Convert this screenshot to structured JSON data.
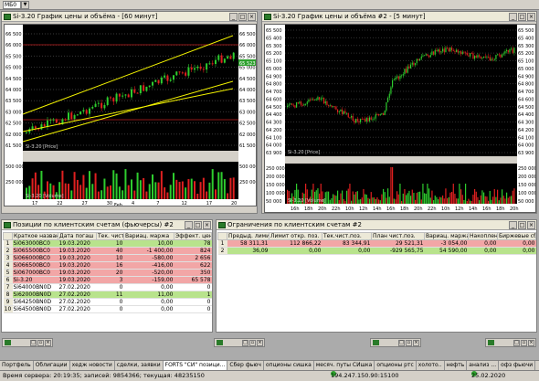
{
  "toolbar": {
    "combo_value": "MБ0"
  },
  "chart1": {
    "title": "Si-3.20 График цены и объёма - [60 минут]",
    "price_axis": [
      "66 500",
      "66 000",
      "65 500",
      "65 000",
      "64 500",
      "64 000",
      "63 500",
      "63 000",
      "62 500",
      "62 000",
      "61 500"
    ],
    "last_price": "65 523",
    "price_label": "Si-3.20 [Price]",
    "volume_axis": [
      "500 000",
      "250 000"
    ],
    "volume_label": "Si-3.20 [Volume]",
    "date_ticks": [
      "17",
      "22",
      "27",
      "30",
      "4",
      "7",
      "12",
      "17",
      "20"
    ],
    "month_label": "Feb"
  },
  "chart2": {
    "title": "Si-3.20 График цены и объёма #2 - [5 минут]",
    "price_axis": [
      "65 500",
      "65 400",
      "65 300",
      "65 200",
      "65 100",
      "65 000",
      "64 900",
      "64 800",
      "64 700",
      "64 600",
      "64 500",
      "64 400",
      "64 300",
      "64 200",
      "64 100",
      "64 000",
      "63 900"
    ],
    "price_label": "Si-3.20 [Price]",
    "volume_axis": [
      "250 000",
      "200 000",
      "150 000",
      "100 000",
      "50 000"
    ],
    "volume_label": "Si-3.20 [Volume]",
    "time_ticks": [
      "16h",
      "18h",
      "20h",
      "22h",
      "10h",
      "12h",
      "14h",
      "16h",
      "18h",
      "20h",
      "22h",
      "10h",
      "12h",
      "14h",
      "16h",
      "18h",
      "20h"
    ]
  },
  "positions": {
    "title": "Позиции по клиентским счетам (фьючерсы) #2",
    "columns": [
      "Краткое название",
      "Дата погаш",
      "Тек. чист.по",
      "Вариац. маржа",
      "Эффект. цен"
    ],
    "rows": [
      {
        "n": "1",
        "name": "Si063000BC0",
        "date": "19.03.2020",
        "net": "10",
        "vm": "10,00",
        "price": "78",
        "style": "green"
      },
      {
        "n": "2",
        "name": "Si065500BC0",
        "date": "19.03.2020",
        "net": "40",
        "vm": "-1 400,00",
        "price": "824",
        "style": "red"
      },
      {
        "n": "3",
        "name": "Si066000BC0",
        "date": "19.03.2020",
        "net": "10",
        "vm": "-580,00",
        "price": "2 656",
        "style": "red"
      },
      {
        "n": "4",
        "name": "Si066500BC0",
        "date": "19.03.2020",
        "net": "16",
        "vm": "-416,00",
        "price": "622",
        "style": "red"
      },
      {
        "n": "5",
        "name": "Si067000BC0",
        "date": "19.03.2020",
        "net": "20",
        "vm": "-520,00",
        "price": "350",
        "style": "red"
      },
      {
        "n": "6",
        "name": "Si-3.20",
        "date": "19.03.2020",
        "net": "3",
        "vm": "-159,00",
        "price": "65 578",
        "style": "red"
      },
      {
        "n": "7",
        "name": "Si64000BN0D",
        "date": "27.02.2020",
        "net": "0",
        "vm": "0,00",
        "price": "0",
        "style": "white"
      },
      {
        "n": "8",
        "name": "Si62000BN0D",
        "date": "27.02.2020",
        "net": "11",
        "vm": "11,00",
        "price": "1",
        "style": "green"
      },
      {
        "n": "9",
        "name": "Si64250BN0D",
        "date": "27.02.2020",
        "net": "0",
        "vm": "0,00",
        "price": "0",
        "style": "white"
      },
      {
        "n": "10",
        "name": "Si64500BN0D",
        "date": "27.02.2020",
        "net": "0",
        "vm": "0,00",
        "price": "0",
        "style": "white"
      }
    ]
  },
  "limits": {
    "title": "Ограничения по клиентским счетам #2",
    "columns": [
      "Предыд. лимит",
      "Лимит откр. поз.",
      "Тек.чист.поз.",
      "План чист.поз.",
      "Вариац. маржа",
      "Накоплен. д",
      "Биржевые сборы"
    ],
    "rows": [
      {
        "n": "1",
        "c": [
          "58 311,31",
          "112 866,22",
          "83 344,91",
          "29 521,31",
          "-3 054,00",
          "0,00",
          "0,00"
        ],
        "style": "red"
      },
      {
        "n": "2",
        "c": [
          "36,09",
          "0,00",
          "0,00",
          "-929 565,75",
          "54 590,00",
          "0,00",
          "0,00"
        ],
        "style": "green"
      }
    ]
  },
  "tabs": [
    "Портфель",
    "Облигации",
    "хедж новости",
    "сделки, заявки",
    "FORTS \"СИ\" позици...",
    "Сбер фьюч",
    "опционы сишка",
    "месяч. путы СИшка",
    "опционы ртс",
    "холото..",
    "нефть",
    "анализ ...",
    "офз фьючи"
  ],
  "status": {
    "server": "Время сервера: 20:19:35; записей: 9854366; текущая: 48235150",
    "connection": "194.247.150.90:15100",
    "date": "25.02.2020"
  },
  "colors": {
    "up": "#2ecc2e",
    "down": "#e02020",
    "channel": "#f5f500",
    "chart_bg": "#000000"
  }
}
